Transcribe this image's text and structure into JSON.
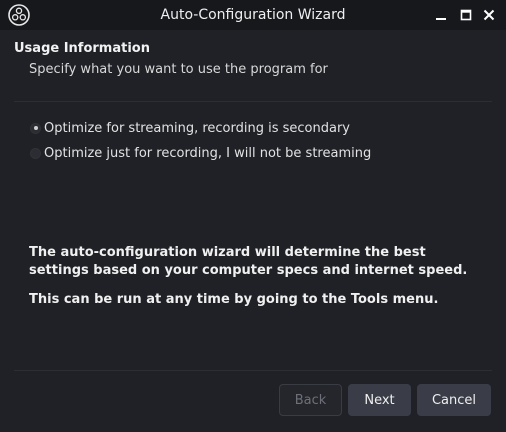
{
  "window": {
    "title": "Auto-Configuration Wizard"
  },
  "icons": {
    "app": "obs-logo-icon",
    "minimize": "minimize-icon",
    "maximize": "maximize-icon",
    "close": "close-icon"
  },
  "section": {
    "title": "Usage Information",
    "subtitle": "Specify what you want to use the program for"
  },
  "options": [
    {
      "label": "Optimize for streaming, recording is secondary",
      "selected": true
    },
    {
      "label": "Optimize just for recording, I will not be streaming",
      "selected": false
    }
  ],
  "info": {
    "paragraph1": "The auto-configuration wizard will determine the best settings based on your computer specs and internet speed.",
    "paragraph2": "This can be run at any time by going to the Tools menu."
  },
  "buttons": {
    "back": "Back",
    "next": "Next",
    "cancel": "Cancel"
  },
  "colors": {
    "background": "#1f2126",
    "titlebar": "#17181c",
    "button": "#3a3d47"
  }
}
